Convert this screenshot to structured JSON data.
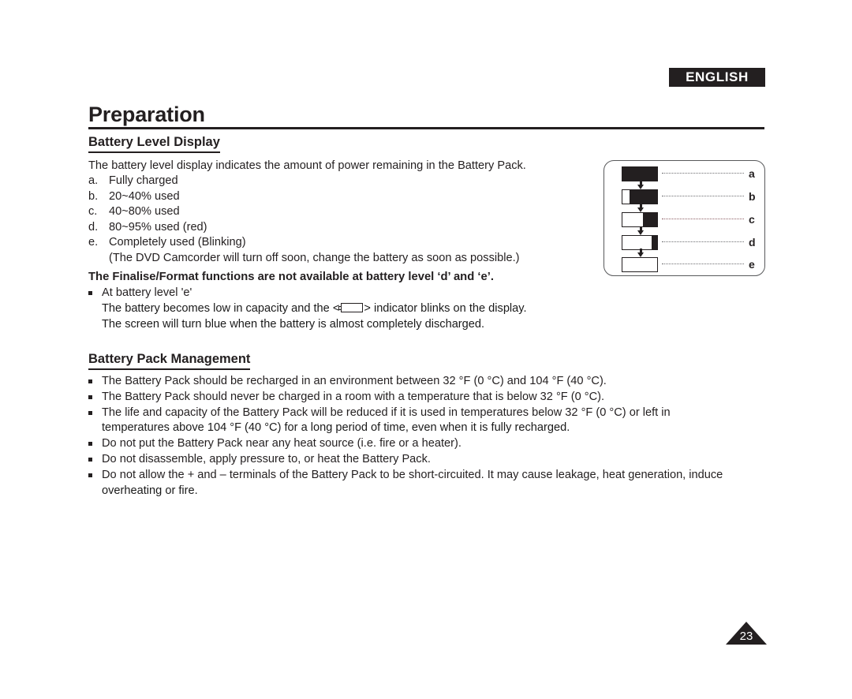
{
  "header": {
    "language_badge": "ENGLISH"
  },
  "chapter": {
    "title": "Preparation"
  },
  "sections": {
    "battery_level_display": {
      "heading": "Battery Level Display",
      "intro": "The battery level display indicates the amount of power remaining in the Battery Pack.",
      "levels": [
        {
          "marker": "a.",
          "text": "Fully charged"
        },
        {
          "marker": "b.",
          "text": "20~40% used"
        },
        {
          "marker": "c.",
          "text": "40~80% used"
        },
        {
          "marker": "d.",
          "text": "80~95% used (red)"
        },
        {
          "marker": "e.",
          "text": "Completely used (Blinking)"
        }
      ],
      "level_note": "(The DVD Camcorder will turn off soon, change the battery as soon as possible.)"
    },
    "finalise_note": {
      "heading": "The Finalise/Format functions are not available at battery level ‘d’ and ‘e’.",
      "bullet": "At battery level 'e'",
      "line_before_icon": "The battery becomes low in capacity and the <",
      "line_after_icon": "> indicator blinks on the display.",
      "line_2": "The screen will turn blue when the battery is almost completely discharged."
    },
    "battery_pack_management": {
      "heading": "Battery Pack Management",
      "bullets": [
        "The Battery Pack should be recharged in an environment between 32 °F (0 °C) and 104 °F (40 °C).",
        "The Battery Pack should never be charged in a room with a temperature that is below 32 °F (0 °C).",
        "The life and capacity of the Battery Pack will be reduced if it is used in temperatures below 32 °F (0 °C) or left in",
        "Do not put the Battery Pack near any heat source (i.e. fire or a heater).",
        "Do not disassemble, apply pressure to, or heat the Battery Pack.",
        "Do not allow the + and – terminals of the Battery Pack to be short-circuited. It may cause leakage, heat generation, induce"
      ],
      "continuation_3": "temperatures above 104 °F (40 °C) for a long period of time, even when it is fully recharged.",
      "continuation_6": "overheating or fire."
    }
  },
  "diagram": {
    "name": "battery-level-indicator-diagram",
    "rows": [
      {
        "label": "a",
        "fill_percent": 100,
        "dots_color": "#6d6e71"
      },
      {
        "label": "b",
        "fill_percent": 80,
        "dots_color": "#6d6e71"
      },
      {
        "label": "c",
        "fill_percent": 42,
        "dots_color": "#8b5c62"
      },
      {
        "label": "d",
        "fill_percent": 15,
        "dots_color": "#6d6e71"
      },
      {
        "label": "e",
        "fill_percent": 0,
        "dots_color": "#6d6e71"
      }
    ]
  },
  "footer": {
    "page_number": "23"
  },
  "colors": {
    "ink": "#231f20",
    "rule": "#58595b",
    "dots": "#6d6e71",
    "dots_red": "#8b5c62"
  }
}
